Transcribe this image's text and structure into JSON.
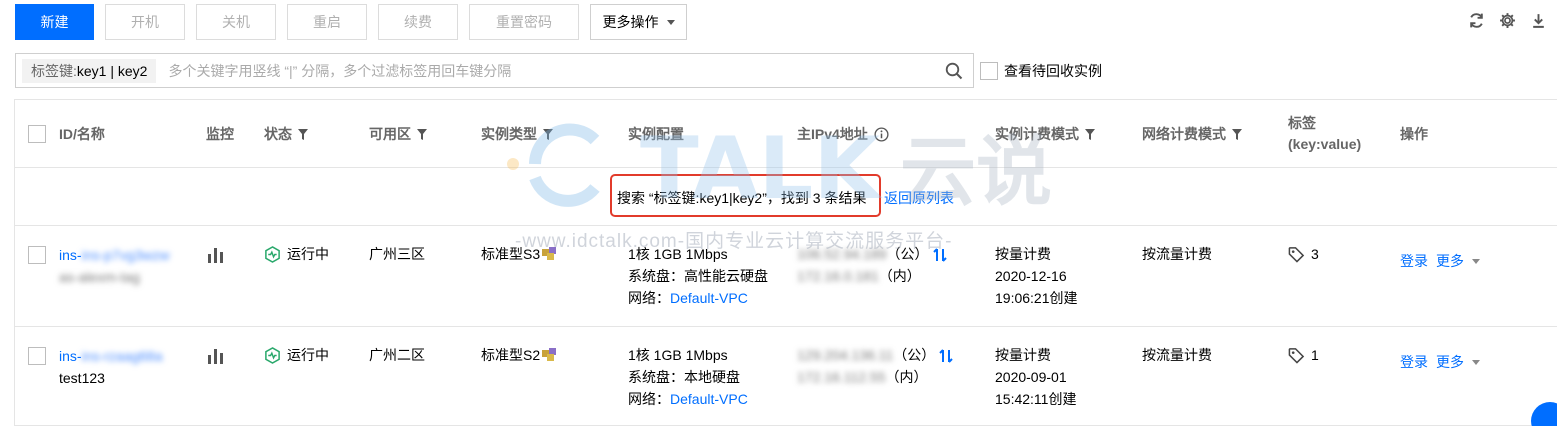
{
  "toolbar": {
    "new_label": "新建",
    "start_label": "开机",
    "shutdown_label": "关机",
    "restart_label": "重启",
    "renew_label": "续费",
    "reset_password_label": "重置密码",
    "more_label": "更多操作"
  },
  "search": {
    "chip_key": "标签键:",
    "chip_value": "key1 | key2",
    "placeholder": "多个关键字用竖线 “|” 分隔，多个过滤标签用回车键分隔"
  },
  "recycle_label": "查看待回收实例",
  "table": {
    "headers": {
      "id_name": "ID/名称",
      "monitor": "监控",
      "status": "状态",
      "zone": "可用区",
      "instance_type": "实例类型",
      "config": "实例配置",
      "ipv4": "主IPv4地址",
      "billing": "实例计费模式",
      "network_billing": "网络计费模式",
      "tags_line1": "标签",
      "tags_line2": "(key:value)",
      "ops": "操作"
    },
    "notice": {
      "text": "搜索 “标签键:key1|key2”，找到 3 条结果",
      "back_link": "返回原列表"
    },
    "rows": [
      {
        "id": "ins-p7vg3wzw",
        "name": "as-alexm-tag",
        "status": "运行中",
        "zone": "广州三区",
        "type": "标准型S3",
        "config_line1": "1核 1GB 1Mbps",
        "config_line2": "系统盘：高性能云硬盘",
        "network_label": "网络：",
        "network_link": "Default-VPC",
        "ip_public": "106.52.94.189",
        "ip_public_suffix": "（公）",
        "ip_private": "172.16.0.181",
        "ip_private_suffix": "（内）",
        "billing_line1": "按量计费",
        "billing_line2": "2020-12-16",
        "billing_line3": "19:06:21创建",
        "network_billing": "按流量计费",
        "tag_count": "3",
        "login": "登录",
        "more": "更多"
      },
      {
        "id": "ins-rzaag68a",
        "name": "test123",
        "status": "运行中",
        "zone": "广州二区",
        "type": "标准型S2",
        "config_line1": "1核 1GB 1Mbps",
        "config_line2": "系统盘：本地硬盘",
        "network_label": "网络：",
        "network_link": "Default-VPC",
        "ip_public": "129.204.136.11",
        "ip_public_suffix": "（公）",
        "ip_private": "172.16.112.55",
        "ip_private_suffix": "（内）",
        "billing_line1": "按量计费",
        "billing_line2": "2020-09-01",
        "billing_line3": "15:42:11创建",
        "network_billing": "按流量计费",
        "tag_count": "1",
        "login": "登录",
        "more": "更多"
      }
    ]
  },
  "watermark": {
    "brand": "TALK",
    "brand_cn": "云说",
    "subtitle": "-www.idctalk.com-国内专业云计算交流服务平台-"
  },
  "colors": {
    "primary": "#006eff",
    "highlight_border": "#e23b2b",
    "running_green": "#29a86b"
  }
}
